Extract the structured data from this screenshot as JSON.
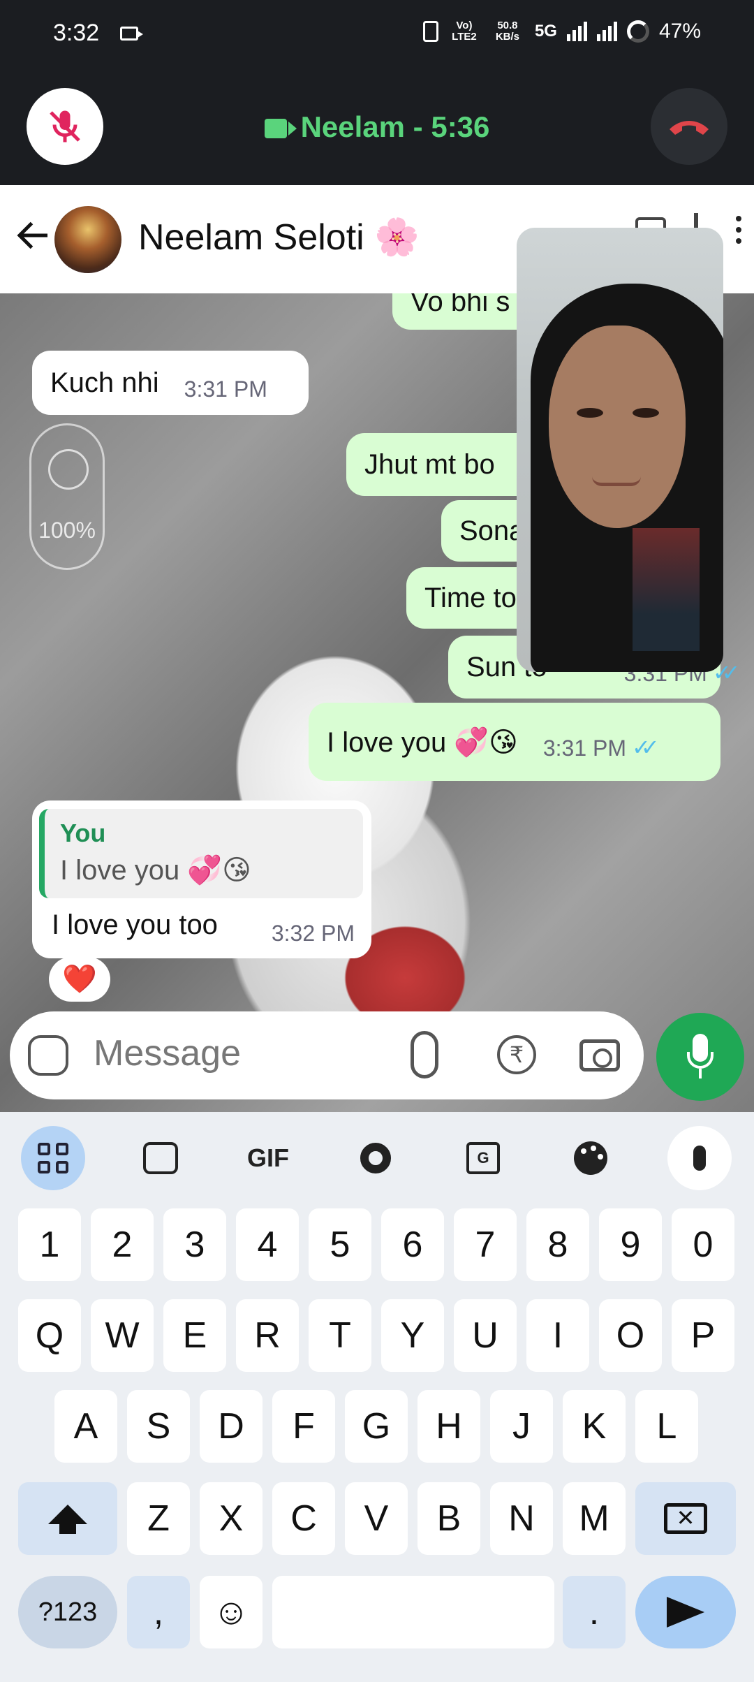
{
  "status_bar": {
    "time": "3:32",
    "network_label": "Vo) LTE2",
    "speed": "50.8 KB/s",
    "network_type": "5G",
    "battery": "47%"
  },
  "call": {
    "title": "Neelam - 5:36",
    "accent_color": "#5ad47c"
  },
  "header": {
    "contact_name": "Neelam Seloti 🌸"
  },
  "beauty": {
    "value": "100%"
  },
  "messages": [
    {
      "direction": "out",
      "text": "Vo bhi s",
      "time": ""
    },
    {
      "direction": "in",
      "text": "Kuch nhi",
      "time": "3:31 PM"
    },
    {
      "direction": "out",
      "text": "Jhut mt bo",
      "time": ""
    },
    {
      "direction": "out",
      "text": "Sona",
      "time": ""
    },
    {
      "direction": "out",
      "text": "Time to",
      "time": ""
    },
    {
      "direction": "out",
      "text": "Sun to",
      "time": "3:31 PM"
    },
    {
      "direction": "out",
      "text": "I love you 💞😘",
      "time": "3:31 PM"
    }
  ],
  "reply_message": {
    "quote_author": "You",
    "quote_text": "I love you 💞😘",
    "text": "I love you too",
    "time": "3:32 PM",
    "reaction": "❤️"
  },
  "input": {
    "placeholder": "Message",
    "currency_symbol": "₹"
  },
  "keyboard": {
    "gif_label": "GIF",
    "row_numbers": [
      "1",
      "2",
      "3",
      "4",
      "5",
      "6",
      "7",
      "8",
      "9",
      "0"
    ],
    "row_q": [
      "Q",
      "W",
      "E",
      "R",
      "T",
      "Y",
      "U",
      "I",
      "O",
      "P"
    ],
    "row_a": [
      "A",
      "S",
      "D",
      "F",
      "G",
      "H",
      "J",
      "K",
      "L"
    ],
    "row_z": [
      "Z",
      "X",
      "C",
      "V",
      "B",
      "N",
      "M"
    ],
    "symbols_label": "?123",
    "comma": ",",
    "emoji": "☺",
    "period": "."
  }
}
